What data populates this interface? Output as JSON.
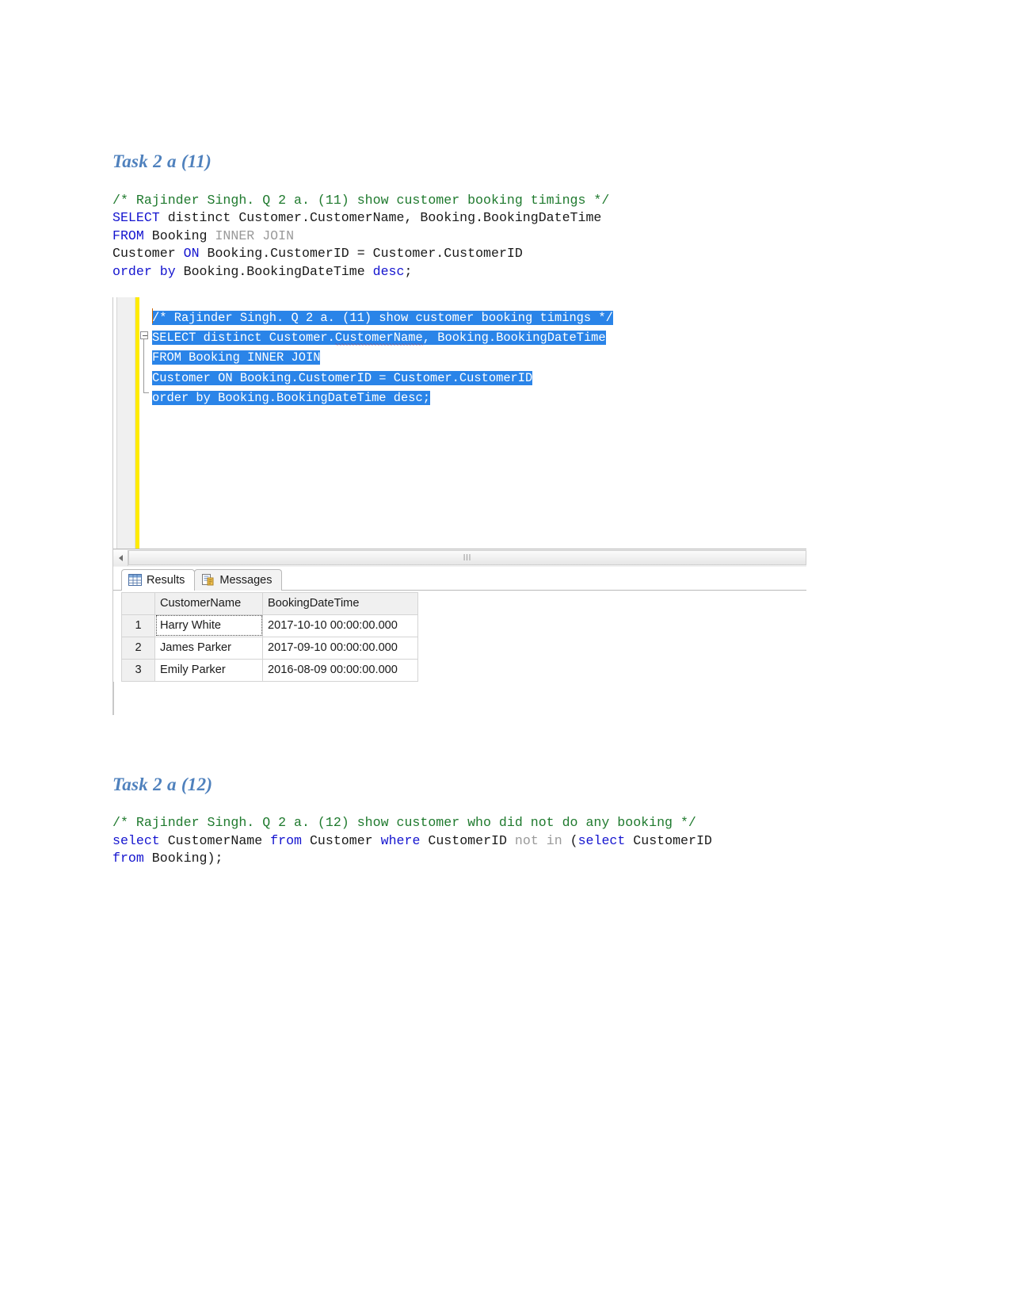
{
  "document": {
    "sections": [
      {
        "heading": "Task 2 a (11)",
        "code_lines": [
          [
            {
              "t": "/* Rajinder Singh. Q 2 a. (11) show customer booking timings */",
              "c": "comment"
            }
          ],
          [
            {
              "t": "SELECT",
              "c": "key"
            },
            {
              "t": " distinct Customer.CustomerName, Booking.BookingDateTime",
              "c": "plain"
            }
          ],
          [
            {
              "t": "FROM",
              "c": "key"
            },
            {
              "t": " Booking ",
              "c": "plain"
            },
            {
              "t": "INNER JOIN",
              "c": "gray"
            }
          ],
          [
            {
              "t": "Customer ",
              "c": "plain"
            },
            {
              "t": "ON",
              "c": "key"
            },
            {
              "t": " Booking.CustomerID = Customer.CustomerID",
              "c": "plain"
            }
          ],
          [
            {
              "t": "order by",
              "c": "key"
            },
            {
              "t": " Booking.BookingDateTime ",
              "c": "plain"
            },
            {
              "t": "desc",
              "c": "key"
            },
            {
              "t": ";",
              "c": "plain"
            }
          ]
        ]
      },
      {
        "heading": "Task 2 a (12)",
        "code_lines": [
          [
            {
              "t": "/* Rajinder Singh. Q 2 a. (12) show customer who did not do any booking */",
              "c": "comment"
            }
          ],
          [
            {
              "t": "select",
              "c": "key"
            },
            {
              "t": " CustomerName ",
              "c": "plain"
            },
            {
              "t": "from",
              "c": "key"
            },
            {
              "t": " Customer ",
              "c": "plain"
            },
            {
              "t": "where",
              "c": "key"
            },
            {
              "t": " CustomerID ",
              "c": "plain"
            },
            {
              "t": "not in",
              "c": "gray"
            },
            {
              "t": " (",
              "c": "plain"
            },
            {
              "t": "select",
              "c": "key"
            },
            {
              "t": " CustomerID",
              "c": "plain"
            }
          ],
          [
            {
              "t": "from",
              "c": "key"
            },
            {
              "t": " Booking);",
              "c": "plain"
            }
          ]
        ]
      }
    ]
  },
  "ssms": {
    "editor": {
      "lines": [
        "/* Rajinder Singh. Q 2 a. (11) show customer booking timings */",
        "SELECT distinct Customer.CustomerName, Booking.BookingDateTime",
        "FROM Booking INNER JOIN",
        "Customer ON Booking.CustomerID = Customer.CustomerID",
        "order by Booking.BookingDateTime desc;"
      ],
      "line2_part_a": "SELECT distinct Customer.",
      "line2_squiggle": "CustomerName",
      "line2_part_b": ", Booking.BookingDateTime",
      "selection_color": "#2a84e8",
      "change_bar_color": "#ffeb00"
    },
    "scrollbar": {
      "grip": "lll"
    },
    "tabs": [
      {
        "label": "Results",
        "icon": "grid-icon",
        "active": true
      },
      {
        "label": "Messages",
        "icon": "messages-icon",
        "active": false
      }
    ],
    "results_grid": {
      "columns": [
        "",
        "CustomerName",
        "BookingDateTime"
      ],
      "rows": [
        {
          "num": "1",
          "CustomerName": "Harry White",
          "BookingDateTime": "2017-10-10 00:00:00.000"
        },
        {
          "num": "2",
          "CustomerName": "James Parker",
          "BookingDateTime": "2017-09-10 00:00:00.000"
        },
        {
          "num": "3",
          "CustomerName": "Emily Parker",
          "BookingDateTime": "2016-08-09 00:00:00.000"
        }
      ]
    }
  }
}
